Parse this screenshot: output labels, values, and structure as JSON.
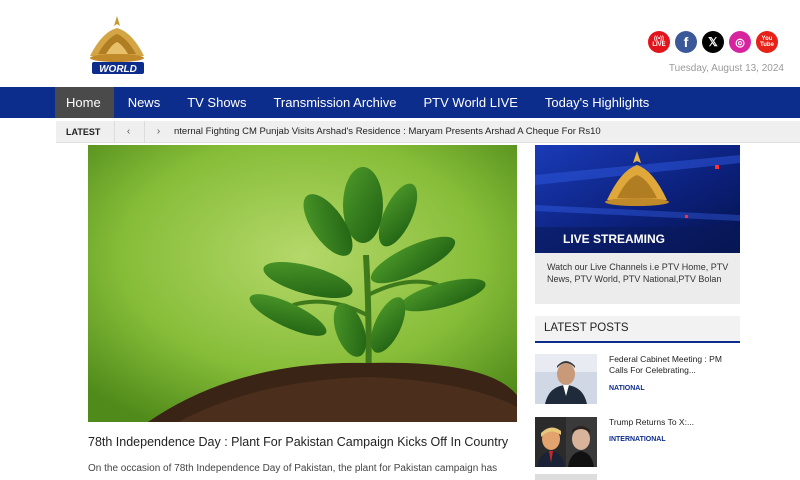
{
  "header": {
    "logo_text": "WORLD",
    "date": "Tuesday, August 13, 2024",
    "socials": [
      {
        "name": "live",
        "glyph_top": "((•))",
        "glyph": "LIVE"
      },
      {
        "name": "facebook",
        "glyph": "f"
      },
      {
        "name": "x",
        "glyph": "𝕏"
      },
      {
        "name": "instagram",
        "glyph": "◎"
      },
      {
        "name": "youtube",
        "glyph_top": "You",
        "glyph": "Tube"
      }
    ]
  },
  "nav": {
    "items": [
      "Home",
      "News",
      "TV Shows",
      "Transmission Archive",
      "PTV World LIVE",
      "Today's Highlights"
    ]
  },
  "ticker": {
    "label": "LATEST",
    "prev": "‹",
    "next": "›",
    "text": "nternal Fighting   CM Punjab Visits Arshad's Residence : Maryam Presents Arshad A Cheque For Rs10"
  },
  "article": {
    "title": "78th Independence Day : Plant For Pakistan Campaign Kicks Off In Country",
    "excerpt": "On the occasion of 78th Independence Day of Pakistan, the plant for Pakistan campaign has"
  },
  "live_card": {
    "banner": "LIVE STREAMING",
    "text": "Watch our Live Channels i.e PTV Home, PTV News, PTV World, PTV National,PTV Bolan"
  },
  "latest_posts": {
    "heading": "LATEST POSTS",
    "posts": [
      {
        "title": "Federal Cabinet Meeting : PM Calls For Celebrating...",
        "category": "NATIONAL"
      },
      {
        "title": "Trump Returns To X:...",
        "category": "INTERNATIONAL"
      }
    ]
  },
  "colors": {
    "nav_bg": "#0d2d8c",
    "nav_active": "#4a4a4a",
    "accent": "#0d2d8c"
  }
}
